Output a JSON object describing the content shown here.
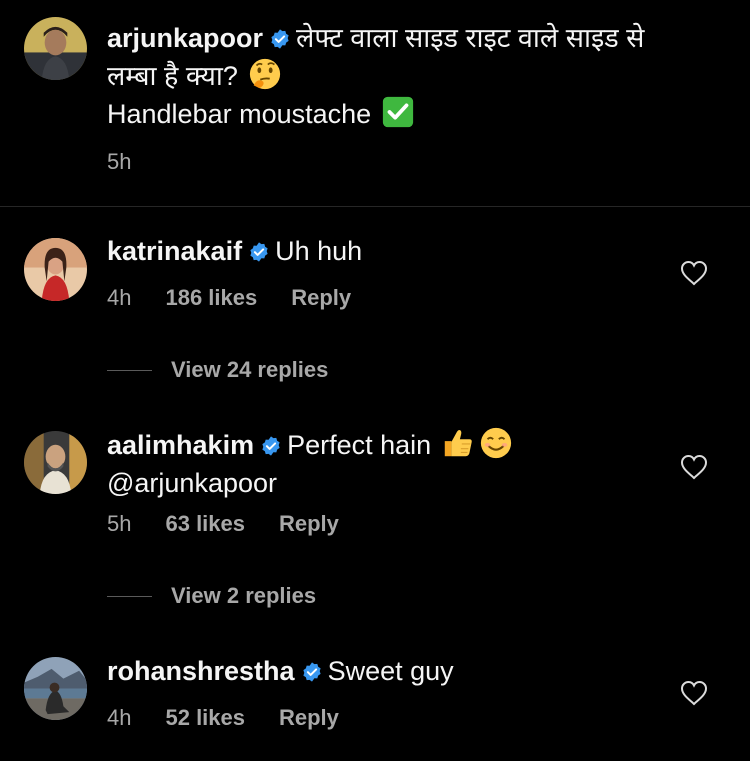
{
  "caption": {
    "username": "arjunkapoor",
    "text_line1": "लेफ्ट वाला साइड राइट वाले साइड से",
    "text_line2": "लम्बा है क्या?",
    "text_line3": "Handlebar moustache",
    "time": "5h"
  },
  "comments": [
    {
      "username": "katrinakaif",
      "text": "Uh huh",
      "time": "4h",
      "likes": "186 likes",
      "reply": "Reply",
      "view_replies": "View 24 replies"
    },
    {
      "username": "aalimhakim",
      "text": "Perfect hain",
      "mention": "@arjunkapoor",
      "time": "5h",
      "likes": "63 likes",
      "reply": "Reply",
      "view_replies": "View 2 replies"
    },
    {
      "username": "rohanshrestha",
      "text": "Sweet guy",
      "time": "4h",
      "likes": "52 likes",
      "reply": "Reply"
    }
  ],
  "colors": {
    "background": "#000000",
    "text": "#f5f5f5",
    "secondary_text": "#a8a8a8",
    "verified_badge": "#3897f0",
    "checkmark_emoji": "#3fb83f"
  }
}
